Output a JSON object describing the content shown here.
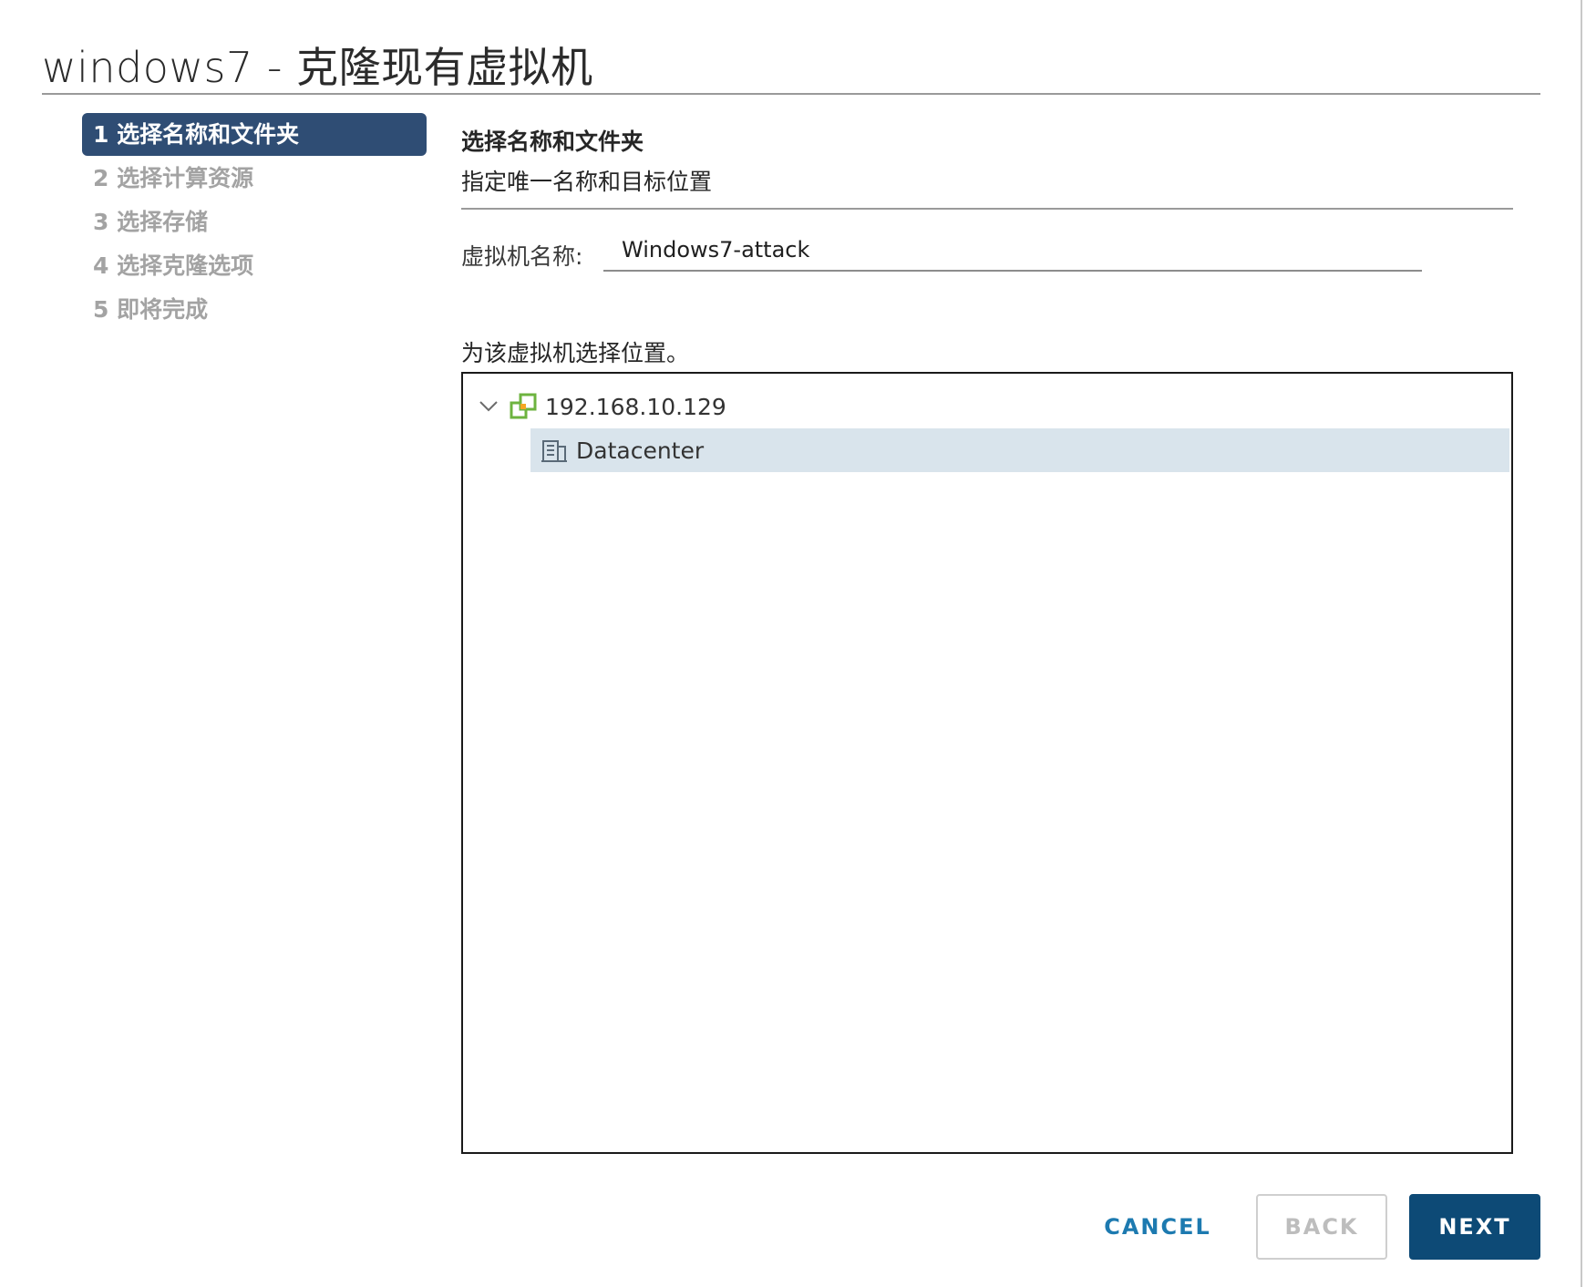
{
  "dialog": {
    "title": "windows7 - 克隆现有虚拟机"
  },
  "steps": [
    {
      "label": "1 选择名称和文件夹",
      "active": true
    },
    {
      "label": "2 选择计算资源",
      "active": false
    },
    {
      "label": "3 选择存储",
      "active": false
    },
    {
      "label": "4 选择克隆选项",
      "active": false
    },
    {
      "label": "5 即将完成",
      "active": false
    }
  ],
  "main": {
    "section_title": "选择名称和文件夹",
    "section_subtitle": "指定唯一名称和目标位置",
    "vm_name_label": "虚拟机名称:",
    "vm_name_value": "Windows7-attack",
    "location_label": "为该虚拟机选择位置。",
    "tree": {
      "root": {
        "label": "192.168.10.129",
        "icon": "vcenter-host-icon",
        "expanded": true
      },
      "children": [
        {
          "label": "Datacenter",
          "icon": "datacenter-icon",
          "selected": true
        }
      ]
    }
  },
  "footer": {
    "cancel_label": "CANCEL",
    "back_label": "BACK",
    "next_label": "NEXT"
  },
  "colors": {
    "active_step_bg": "#2f4d74",
    "selected_row_bg": "#d9e4ec",
    "primary_button": "#0d4a76",
    "link_blue": "#1d7ab0",
    "host_icon_green": "#6db33f"
  }
}
